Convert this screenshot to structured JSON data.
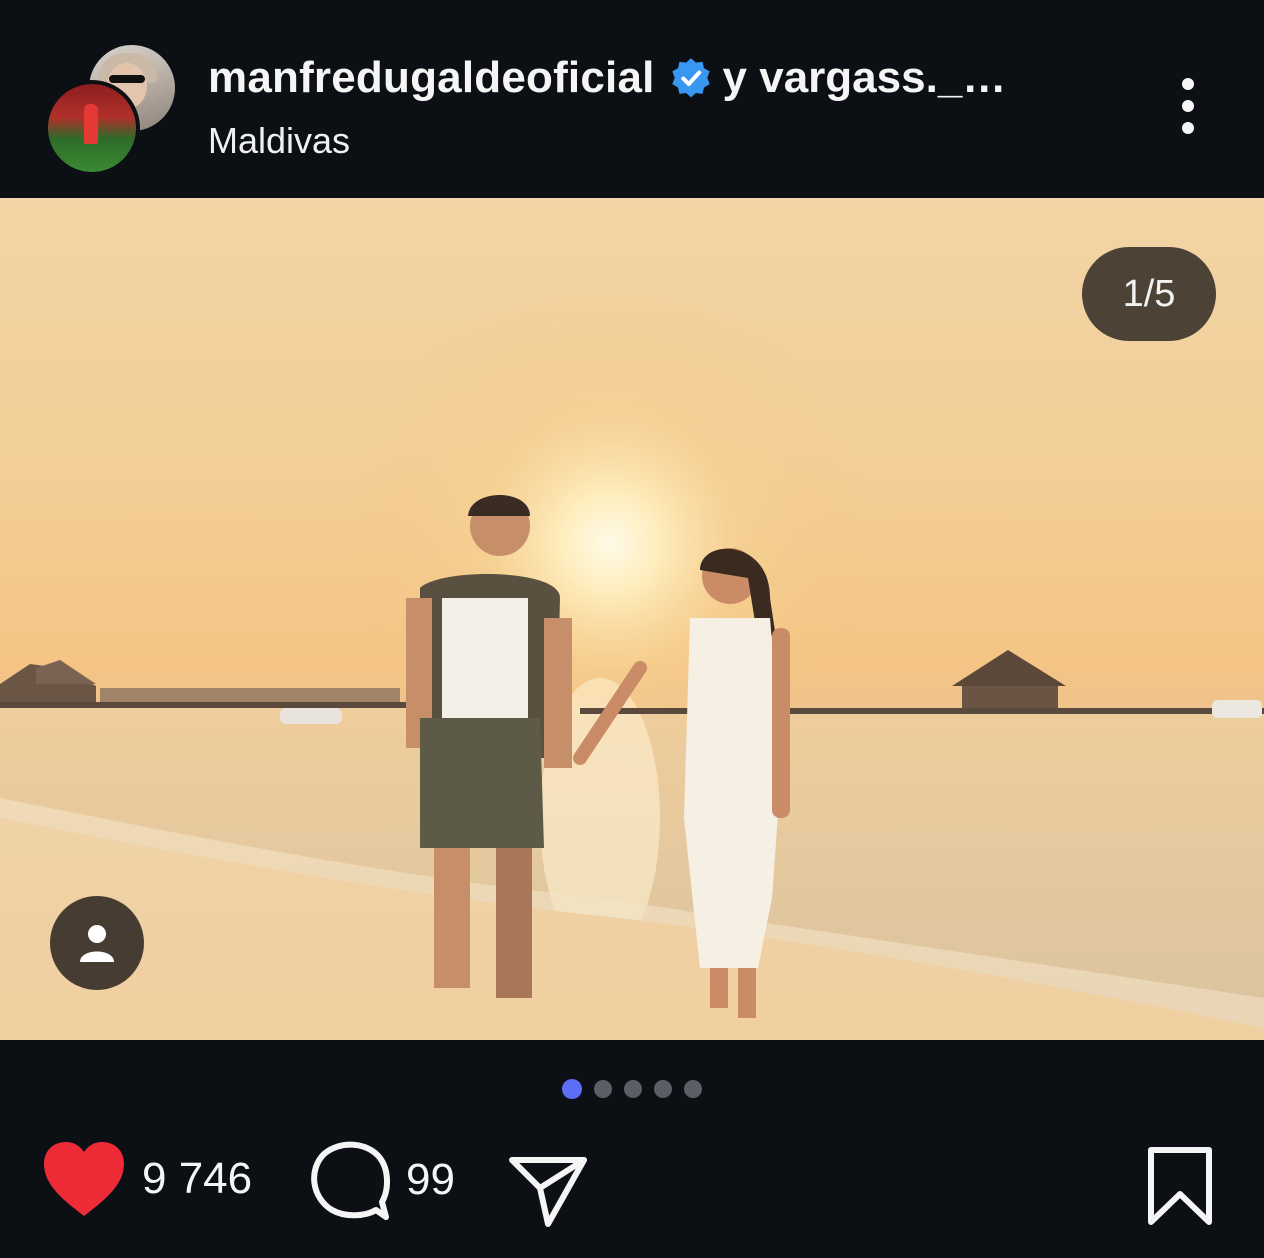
{
  "post": {
    "username": "manfredugaldeoficial",
    "collab": "y vargass._…",
    "location": "Maldivas",
    "counter": "1/5",
    "carousel_total": 5,
    "carousel_index": 1
  },
  "actions": {
    "likes": "9 746",
    "comments": "99"
  },
  "colors": {
    "background": "#0c1014",
    "verified": "#3897f0",
    "like": "#ed2c38",
    "active_dot": "#5b6ef5"
  },
  "icons": [
    "verified-badge-icon",
    "more-options-icon",
    "tag-user-icon",
    "heart-icon",
    "comment-icon",
    "share-icon",
    "bookmark-icon"
  ]
}
